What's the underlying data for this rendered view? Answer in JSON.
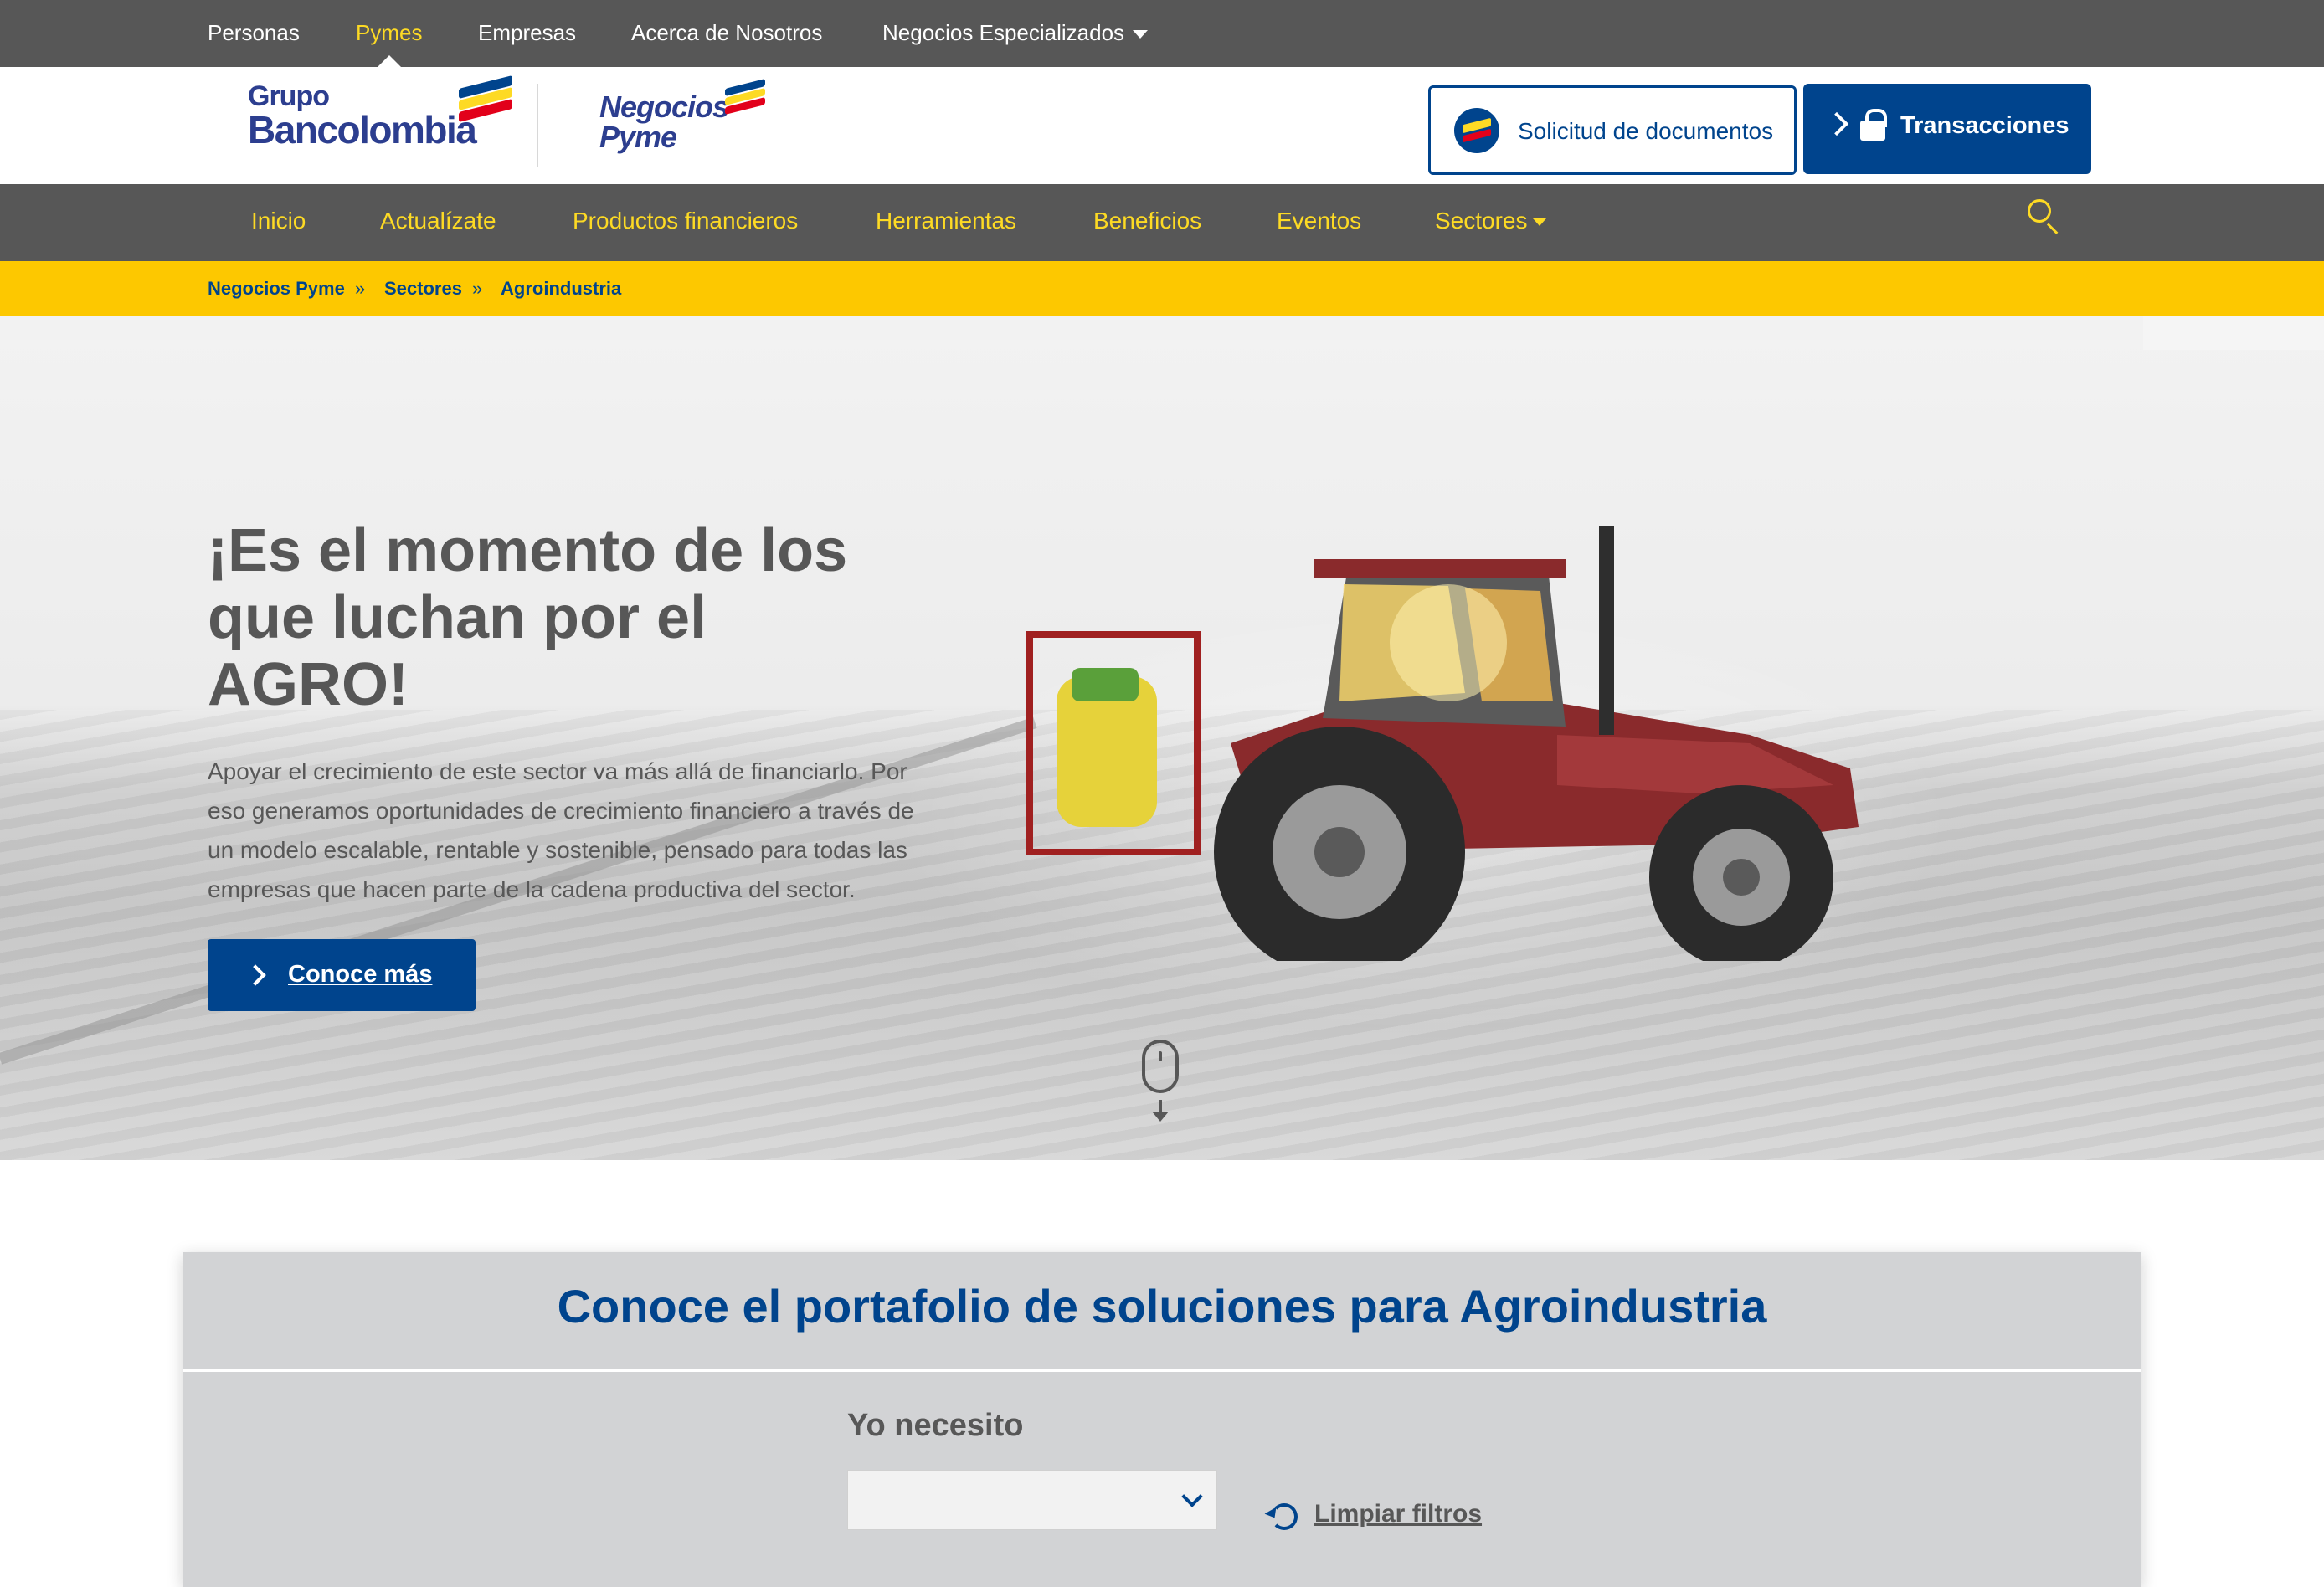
{
  "topnav": {
    "items": [
      "Personas",
      "Pymes",
      "Empresas",
      "Acerca de Nosotros"
    ],
    "specialized": "Negocios Especializados",
    "active": "Pymes"
  },
  "header": {
    "logo_grupo_line1": "Grupo",
    "logo_grupo_line2": "Bancolombia",
    "logo_pyme_line1": "Negocios",
    "logo_pyme_line2": "Pyme",
    "docs_button": "Solicitud de documentos",
    "transactions_button": "Transacciones"
  },
  "mainnav": {
    "items": [
      "Inicio",
      "Actualízate",
      "Productos financieros",
      "Herramientas",
      "Beneficios",
      "Eventos"
    ],
    "sectores": "Sectores"
  },
  "breadcrumb": {
    "items": [
      "Negocios Pyme",
      "Sectores",
      "Agroindustria"
    ],
    "separator": "»"
  },
  "hero": {
    "title_lines": [
      "¡Es el momento de los",
      "que luchan por el",
      "AGRO!"
    ],
    "text_lines": [
      "Apoyar el crecimiento de este sector va más allá de financiarlo. Por",
      "eso generamos oportunidades de crecimiento financiero a través de",
      "un modelo escalable, rentable y sostenible, pensado para todas las",
      "empresas que hacen parte de la cadena productiva del sector."
    ],
    "cta": "Conoce más"
  },
  "portfolio": {
    "title": "Conoce el portafolio de soluciones para Agroindustria",
    "need_label": "Yo necesito",
    "select_value": "",
    "clear_filters": "Limpiar filtros"
  },
  "colors": {
    "brand_blue": "#00448d",
    "brand_yellow": "#fdda24",
    "breadcrumb_yellow": "#fdc800",
    "nav_gray": "#575757"
  }
}
